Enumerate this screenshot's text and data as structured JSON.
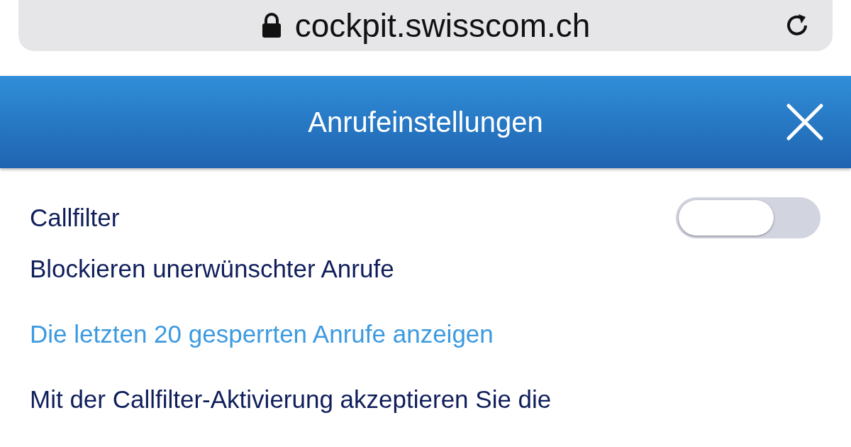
{
  "browser": {
    "url": "cockpit.swisscom.ch"
  },
  "header": {
    "title": "Anrufeinstellungen"
  },
  "callfilter": {
    "label": "Callfilter",
    "on": false
  },
  "description": "Blockieren unerwünschter Anrufe",
  "link": "Die letzten 20 gesperrten Anrufe anzeigen",
  "notice": "Mit der Callfilter-Aktivierung akzeptieren Sie die"
}
